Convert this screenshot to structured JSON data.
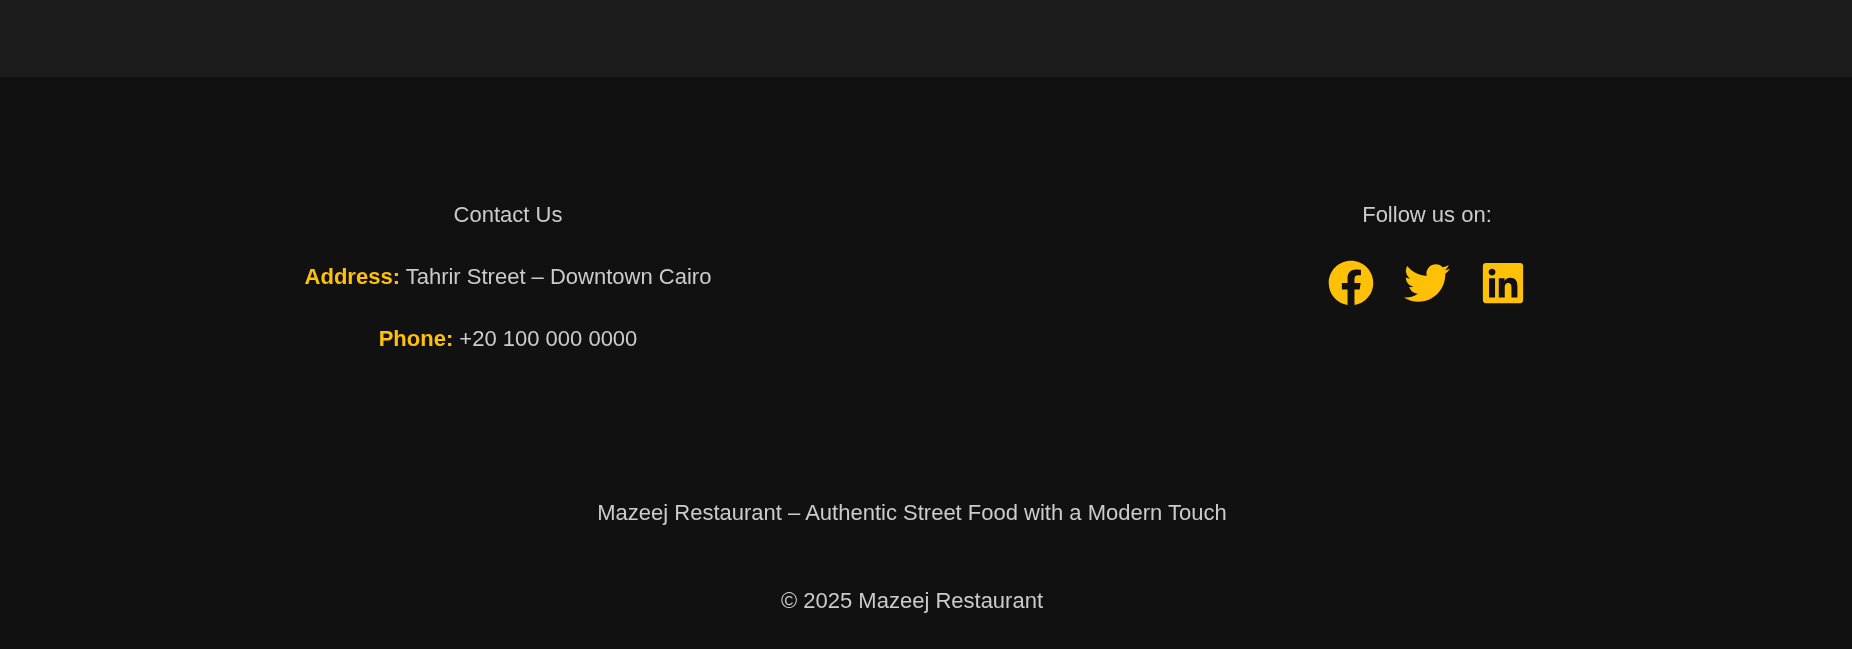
{
  "contact": {
    "title": "Contact Us",
    "lines": [
      "**Address:** Tahrir Street – Downtown Cairo",
      "**Phone:** +20 100 000 0000"
    ]
  },
  "social": {
    "title": "Follow us on:",
    "links": [
      {
        "kind": "facebook"
      },
      {
        "kind": "twitter"
      },
      {
        "kind": "linkedin"
      }
    ]
  },
  "tagline": "Mazeej Restaurant – Authentic Street Food with a Modern Touch",
  "copyright": "© 2025 Mazeej Restaurant"
}
